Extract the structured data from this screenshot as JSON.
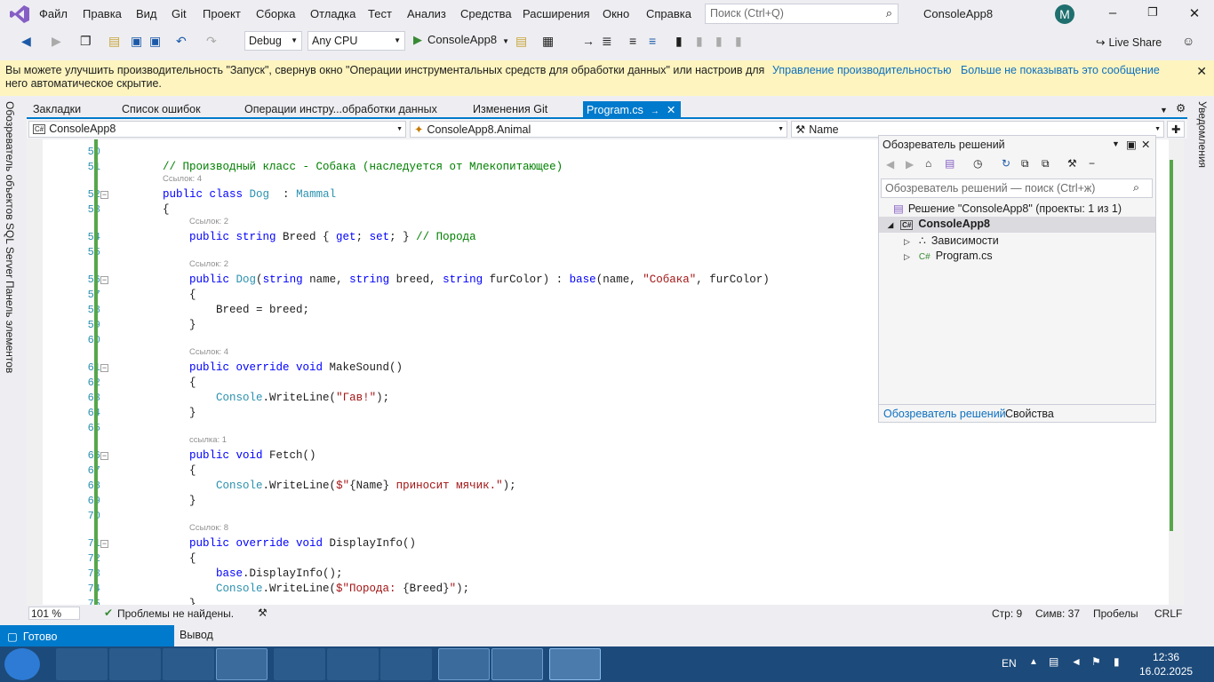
{
  "menubar": {
    "items": [
      "Файл",
      "Правка",
      "Вид",
      "Git",
      "Проект",
      "Сборка",
      "Отладка",
      "Тест",
      "Анализ",
      "Средства",
      "Расширения",
      "Окно",
      "Справка"
    ],
    "search_placeholder": "Поиск (Ctrl+Q)",
    "solution_name": "ConsoleApp8",
    "avatar_letter": "M"
  },
  "toolbar": {
    "config": "Debug",
    "platform": "Any CPU",
    "run_label": "ConsoleApp8",
    "live_share": "Live Share"
  },
  "infobar": {
    "message": "Вы можете улучшить производительность \"Запуск\", свернув окно \"Операции инструментальных средств для обработки данных\" или настроив для него автоматическое скрытие.",
    "link1": "Управление производительностью",
    "link2": "Больше не показывать это сообщение"
  },
  "left_tabs": [
    "Обозреватель объектов SQL Server",
    "Панель элементов"
  ],
  "right_tabs": [
    "Уведомления"
  ],
  "doc_tabs": [
    "Закладки",
    "Список ошибок",
    "Операции инстру...обработки данных",
    "Изменения Git",
    "Program.cs"
  ],
  "navbar": {
    "project": "ConsoleApp8",
    "class": "ConsoleApp8.Animal",
    "member": "Name"
  },
  "code": [
    {
      "n": "50",
      "parts": []
    },
    {
      "n": "51",
      "parts": [
        [
          "cm",
          "    // Производный класс - Собака (наследуется от Млекопитающее)"
        ]
      ]
    },
    {
      "n": "52",
      "lens": "Ссылок: 4",
      "fold": "−",
      "parts": [
        [
          "kw",
          "    public class "
        ],
        [
          "ty",
          "Dog"
        ],
        [
          "",
          "  : "
        ],
        [
          "ty",
          "Mammal"
        ]
      ]
    },
    {
      "n": "53",
      "parts": [
        [
          "",
          "    {"
        ]
      ]
    },
    {
      "n": "54",
      "lens": "Ссылок: 2",
      "parts": [
        [
          "kw",
          "        public string "
        ],
        [
          "",
          "Breed { "
        ],
        [
          "kw",
          "get"
        ],
        [
          "",
          "; "
        ],
        [
          "kw",
          "set"
        ],
        [
          "",
          "; } "
        ],
        [
          "cm",
          "// Порода"
        ]
      ]
    },
    {
      "n": "55",
      "parts": []
    },
    {
      "n": "56",
      "lens": "Ссылок: 2",
      "fold": "−",
      "parts": [
        [
          "kw",
          "        public "
        ],
        [
          "ty",
          "Dog"
        ],
        [
          "",
          "("
        ],
        [
          "kw",
          "string"
        ],
        [
          "",
          " name, "
        ],
        [
          "kw",
          "string"
        ],
        [
          "",
          " breed, "
        ],
        [
          "kw",
          "string"
        ],
        [
          "",
          " furColor) : "
        ],
        [
          "kw",
          "base"
        ],
        [
          "",
          "(name, "
        ],
        [
          "st",
          "\"Собака\""
        ],
        [
          "",
          ", furColor)"
        ]
      ]
    },
    {
      "n": "57",
      "parts": [
        [
          "",
          "        {"
        ]
      ]
    },
    {
      "n": "58",
      "parts": [
        [
          "",
          "            Breed = breed;"
        ]
      ]
    },
    {
      "n": "59",
      "parts": [
        [
          "",
          "        }"
        ]
      ]
    },
    {
      "n": "60",
      "parts": []
    },
    {
      "n": "61",
      "lens": "Ссылок: 4",
      "fold": "−",
      "parts": [
        [
          "kw",
          "        public override void "
        ],
        [
          "",
          "MakeSound()"
        ]
      ]
    },
    {
      "n": "62",
      "parts": [
        [
          "",
          "        {"
        ]
      ]
    },
    {
      "n": "63",
      "parts": [
        [
          "ty",
          "            Console"
        ],
        [
          "",
          "."
        ],
        [
          "",
          "WriteLine("
        ],
        [
          "st",
          "\"Гав!\""
        ],
        [
          "",
          ");"
        ]
      ]
    },
    {
      "n": "64",
      "parts": [
        [
          "",
          "        }"
        ]
      ]
    },
    {
      "n": "65",
      "parts": []
    },
    {
      "n": "66",
      "lens": "ссылка: 1",
      "fold": "−",
      "parts": [
        [
          "kw",
          "        public void "
        ],
        [
          "",
          "Fetch()"
        ]
      ]
    },
    {
      "n": "67",
      "parts": [
        [
          "",
          "        {"
        ]
      ]
    },
    {
      "n": "68",
      "parts": [
        [
          "ty",
          "            Console"
        ],
        [
          "",
          "."
        ],
        [
          "",
          "WriteLine("
        ],
        [
          "st",
          "$\""
        ],
        [
          "",
          "{Name}"
        ],
        [
          "st",
          " приносит мячик.\""
        ],
        [
          "",
          ");"
        ]
      ]
    },
    {
      "n": "69",
      "parts": [
        [
          "",
          "        }"
        ]
      ]
    },
    {
      "n": "70",
      "parts": []
    },
    {
      "n": "71",
      "lens": "Ссылок: 8",
      "fold": "−",
      "parts": [
        [
          "kw",
          "        public override void "
        ],
        [
          "",
          "DisplayInfo()"
        ]
      ]
    },
    {
      "n": "72",
      "parts": [
        [
          "",
          "        {"
        ]
      ]
    },
    {
      "n": "73",
      "parts": [
        [
          "kw",
          "            base"
        ],
        [
          "",
          ".DisplayInfo();"
        ]
      ]
    },
    {
      "n": "74",
      "parts": [
        [
          "ty",
          "            Console"
        ],
        [
          "",
          ".WriteLine("
        ],
        [
          "st",
          "$\"Порода: "
        ],
        [
          "",
          "{Breed}"
        ],
        [
          "st",
          "\""
        ],
        [
          "",
          ");"
        ]
      ]
    },
    {
      "n": "75",
      "parts": [
        [
          "",
          "        }"
        ]
      ]
    }
  ],
  "status_strip": {
    "zoom": "101 %",
    "problems": "Проблемы не найдены.",
    "line": "Стр: 9",
    "col": "Симв: 37",
    "spaces": "Пробелы",
    "eol": "CRLF"
  },
  "statusbar": {
    "ready": "Готово",
    "output": "Вывод"
  },
  "solution_explorer": {
    "title": "Обозреватель решений",
    "search_placeholder": "Обозреватель решений — поиск (Ctrl+ж)",
    "solution": "Решение \"ConsoleApp8\" (проекты: 1 из 1)",
    "project": "ConsoleApp8",
    "deps": "Зависимости",
    "file": "Program.cs",
    "tab1": "Обозреватель решений",
    "tab2": "Свойства"
  },
  "taskbar": {
    "lang": "EN",
    "time": "12:36",
    "date": "16.02.2025"
  }
}
